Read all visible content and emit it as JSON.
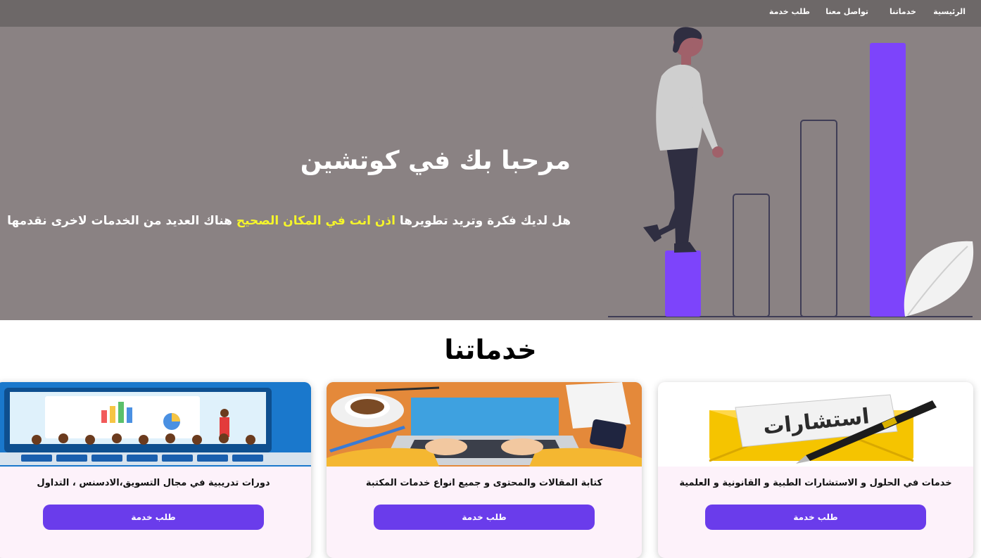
{
  "nav": {
    "home": "الرئيسية",
    "services": "خدماتنا",
    "contact": "تواصل معنا",
    "request": "طلب خدمة"
  },
  "hero": {
    "title": "مرحبا بك في كوتشين",
    "subtitle_part1": "هل لديك فكرة وتريد تطويرها",
    "subtitle_highlight": "اذن انت في المكان الصحيح",
    "subtitle_part2": "هناك العديد من الخدمات لاخرى نقدمها"
  },
  "services": {
    "title": "خدماتنا",
    "cards": [
      {
        "text": "خدمات في الحلول و الاستشارات الطبية و القانونية و العلمية",
        "button": "طلب خدمة",
        "image_word": "استشارات"
      },
      {
        "text": "كتابة المقالات والمحتوى و جميع انواع خدمات المكتبة",
        "button": "طلب خدمة"
      },
      {
        "text": "دورات تدريبية في مجال التسويق،الادسنس ، التداول",
        "button": "طلب خدمة"
      }
    ]
  },
  "colors": {
    "nav_bg": "#6d6868",
    "hero_bg": "#8a8283",
    "accent": "#6a3ceb",
    "highlight": "#f5f52a",
    "card_bg": "#fdf2fa"
  }
}
